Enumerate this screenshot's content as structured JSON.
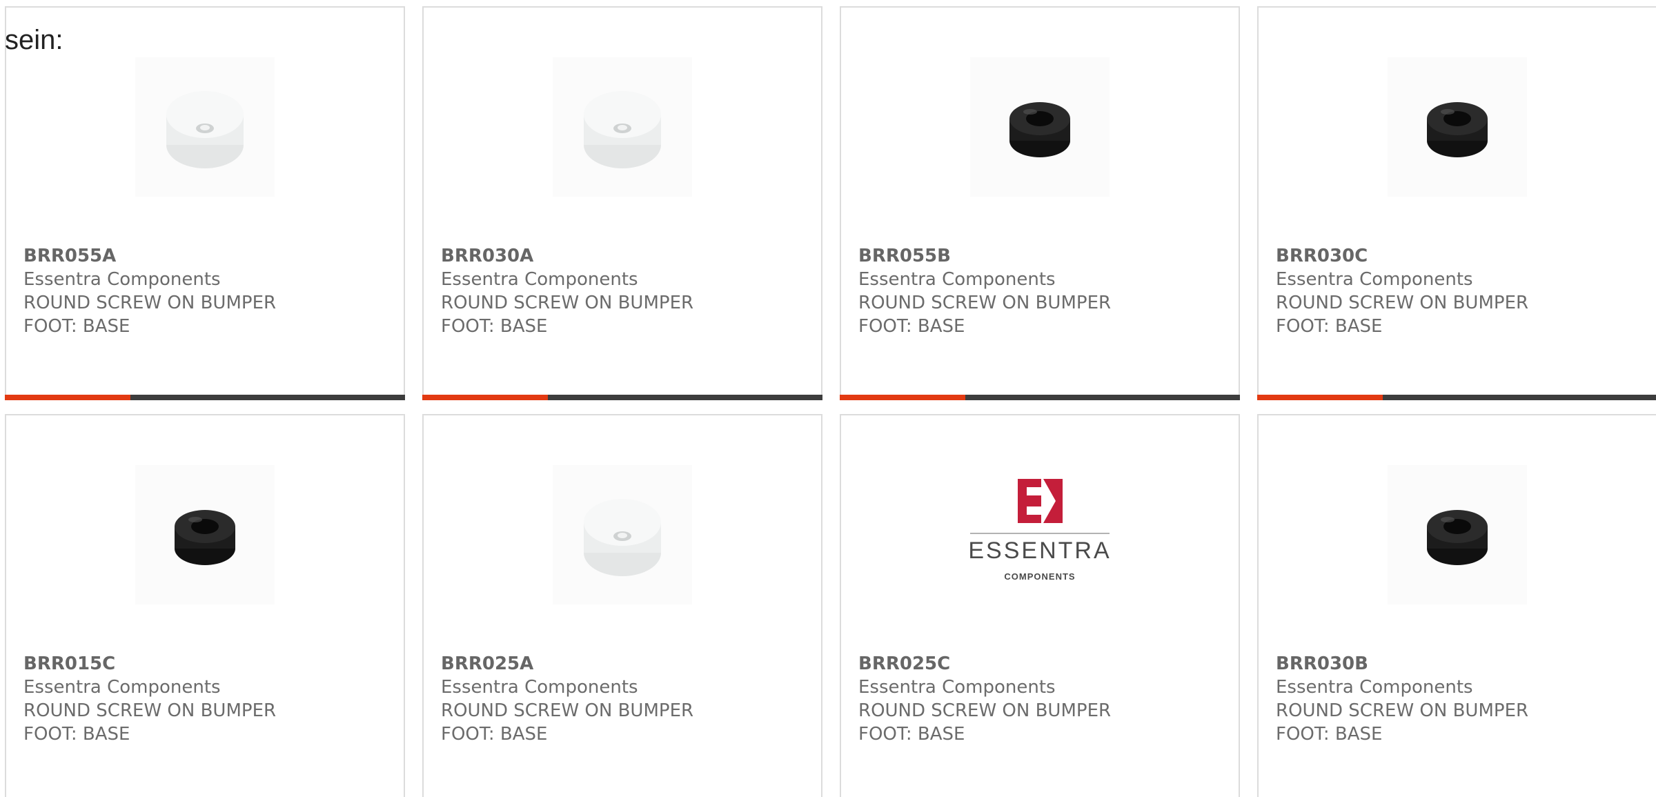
{
  "intro_text": "sein:",
  "colors": {
    "accent": "#e23a12",
    "bar_dark": "#3d3d3d",
    "card_border": "#dcdcdc",
    "text": "#6b6b6b"
  },
  "products": [
    {
      "sku": "BRR055A",
      "brand": "Essentra Components",
      "desc1": "ROUND SCREW ON BUMPER",
      "desc2": "FOOT: BASE",
      "image": "white-bumper-foot"
    },
    {
      "sku": "BRR030A",
      "brand": "Essentra Components",
      "desc1": "ROUND SCREW ON BUMPER",
      "desc2": "FOOT: BASE",
      "image": "white-bumper-foot"
    },
    {
      "sku": "BRR055B",
      "brand": "Essentra Components",
      "desc1": "ROUND SCREW ON BUMPER",
      "desc2": "FOOT: BASE",
      "image": "black-bumper-foot"
    },
    {
      "sku": "BRR030C",
      "brand": "Essentra Components",
      "desc1": "ROUND SCREW ON BUMPER",
      "desc2": "FOOT: BASE",
      "image": "black-bumper-foot"
    },
    {
      "sku": "BRR015C",
      "brand": "Essentra Components",
      "desc1": "ROUND SCREW ON BUMPER",
      "desc2": "FOOT: BASE",
      "image": "black-bumper-foot"
    },
    {
      "sku": "BRR025A",
      "brand": "Essentra Components",
      "desc1": "ROUND SCREW ON BUMPER",
      "desc2": "FOOT: BASE",
      "image": "white-bumper-foot"
    },
    {
      "sku": "BRR025C",
      "brand": "Essentra Components",
      "desc1": "ROUND SCREW ON BUMPER",
      "desc2": "FOOT: BASE",
      "image": "essentra-logo",
      "logo_text": "ESSENTRA",
      "logo_subtext": "COMPONENTS"
    },
    {
      "sku": "BRR030B",
      "brand": "Essentra Components",
      "desc1": "ROUND SCREW ON BUMPER",
      "desc2": "FOOT: BASE",
      "image": "black-bumper-foot"
    }
  ]
}
